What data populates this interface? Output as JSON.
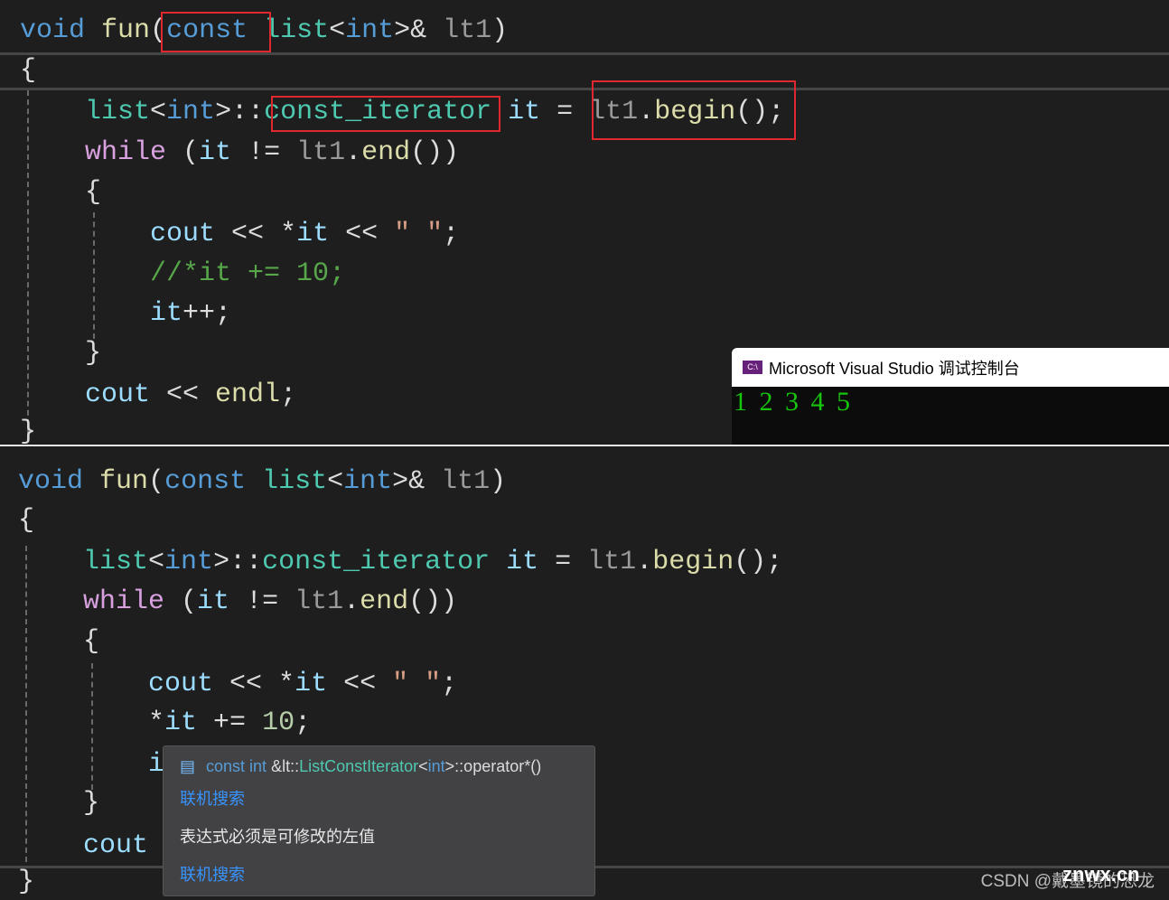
{
  "top": {
    "lines": [
      [
        [
          "void",
          "kw"
        ],
        [
          " ",
          "pl"
        ],
        [
          "fun",
          "fn"
        ],
        [
          "(",
          "pl"
        ],
        [
          "const",
          "kw"
        ],
        [
          " ",
          "pl"
        ],
        [
          "list",
          "ty"
        ],
        [
          "<",
          "pl"
        ],
        [
          "int",
          "kw"
        ],
        [
          ">& ",
          "pl"
        ],
        [
          "lt1",
          "prm"
        ],
        [
          ")",
          "pl"
        ]
      ],
      [
        [
          "{",
          "pl"
        ]
      ],
      [
        [
          "    ",
          "pl"
        ],
        [
          "list",
          "ty"
        ],
        [
          "<",
          "pl"
        ],
        [
          "int",
          "kw"
        ],
        [
          ">::",
          "pl"
        ],
        [
          "const_iterator",
          "ty"
        ],
        [
          " ",
          "pl"
        ],
        [
          "it",
          "var"
        ],
        [
          " = ",
          "pl"
        ],
        [
          "lt1",
          "prm"
        ],
        [
          ".",
          "pl"
        ],
        [
          "begin",
          "fn"
        ],
        [
          "();",
          "pl"
        ]
      ],
      [
        [
          "    ",
          "pl"
        ],
        [
          "while",
          "ctl"
        ],
        [
          " (",
          "pl"
        ],
        [
          "it",
          "var"
        ],
        [
          " != ",
          "pl"
        ],
        [
          "lt1",
          "prm"
        ],
        [
          ".",
          "pl"
        ],
        [
          "end",
          "fn"
        ],
        [
          "())",
          "pl"
        ]
      ],
      [
        [
          "    {",
          "pl"
        ]
      ],
      [
        [
          "        ",
          "pl"
        ],
        [
          "cout",
          "var"
        ],
        [
          " << *",
          "pl"
        ],
        [
          "it",
          "var"
        ],
        [
          " << ",
          "pl"
        ],
        [
          "\" \"",
          "str"
        ],
        [
          ";",
          "pl"
        ]
      ],
      [
        [
          "        ",
          "pl"
        ],
        [
          "//*it += 10;",
          "cm"
        ]
      ],
      [
        [
          "        ",
          "pl"
        ],
        [
          "it",
          "var"
        ],
        [
          "++;",
          "pl"
        ]
      ],
      [
        [
          "    }",
          "pl"
        ]
      ],
      [
        [
          "    ",
          "pl"
        ],
        [
          "cout",
          "var"
        ],
        [
          " << ",
          "pl"
        ],
        [
          "endl",
          "fn"
        ],
        [
          ";",
          "pl"
        ]
      ],
      [
        [
          "}",
          "pl"
        ]
      ]
    ]
  },
  "bottom": {
    "lines": [
      [
        [
          "void",
          "kw"
        ],
        [
          " ",
          "pl"
        ],
        [
          "fun",
          "fn"
        ],
        [
          "(",
          "pl"
        ],
        [
          "const",
          "kw"
        ],
        [
          " ",
          "pl"
        ],
        [
          "list",
          "ty"
        ],
        [
          "<",
          "pl"
        ],
        [
          "int",
          "kw"
        ],
        [
          ">& ",
          "pl"
        ],
        [
          "lt1",
          "prm"
        ],
        [
          ")",
          "pl"
        ]
      ],
      [
        [
          "{",
          "pl"
        ]
      ],
      [
        [
          "    ",
          "pl"
        ],
        [
          "list",
          "ty"
        ],
        [
          "<",
          "pl"
        ],
        [
          "int",
          "kw"
        ],
        [
          ">::",
          "pl"
        ],
        [
          "const_iterator",
          "ty"
        ],
        [
          " ",
          "pl"
        ],
        [
          "it",
          "var"
        ],
        [
          " = ",
          "pl"
        ],
        [
          "lt1",
          "prm"
        ],
        [
          ".",
          "pl"
        ],
        [
          "begin",
          "fn"
        ],
        [
          "();",
          "pl"
        ]
      ],
      [
        [
          "    ",
          "pl"
        ],
        [
          "while",
          "ctl"
        ],
        [
          " (",
          "pl"
        ],
        [
          "it",
          "var"
        ],
        [
          " != ",
          "pl"
        ],
        [
          "lt1",
          "prm"
        ],
        [
          ".",
          "pl"
        ],
        [
          "end",
          "fn"
        ],
        [
          "())",
          "pl"
        ]
      ],
      [
        [
          "    {",
          "pl"
        ]
      ],
      [
        [
          "        ",
          "pl"
        ],
        [
          "cout",
          "var"
        ],
        [
          " << *",
          "pl"
        ],
        [
          "it",
          "var"
        ],
        [
          " << ",
          "pl"
        ],
        [
          "\" \"",
          "str"
        ],
        [
          ";",
          "pl"
        ]
      ],
      [
        [
          "        *",
          "pl"
        ],
        [
          "it",
          "var"
        ],
        [
          " += ",
          "pl"
        ],
        [
          "10",
          "num"
        ],
        [
          ";",
          "pl"
        ]
      ],
      [
        [
          "        ",
          "pl"
        ],
        [
          "i",
          "var"
        ]
      ],
      [
        [
          "    }",
          "pl"
        ]
      ],
      [
        [
          "    ",
          "pl"
        ],
        [
          "cout",
          "var"
        ]
      ],
      [
        [
          "}",
          "pl"
        ]
      ]
    ]
  },
  "console": {
    "title": "Microsoft Visual Studio 调试控制台",
    "icon": "C:\\",
    "output": "1 2 3 4 5"
  },
  "tooltip": {
    "sig_kw": "const int",
    "sig_amp": " &lt::",
    "sig_type": "ListConstIterator",
    "sig_lt": "<",
    "sig_int": "int",
    "sig_rest": ">::operator*()",
    "search1": "联机搜索",
    "error": "表达式必须是可修改的左值",
    "search2": "联机搜索"
  },
  "watermark": {
    "csdn": "CSDN @戴墨镜的恐龙",
    "site": "znwx.cn"
  },
  "colors": {
    "keyword": "#569cd6",
    "type": "#4ec9b0",
    "function": "#dcdcaa",
    "highlight": "#e0282e",
    "console_text": "#16c60c"
  }
}
